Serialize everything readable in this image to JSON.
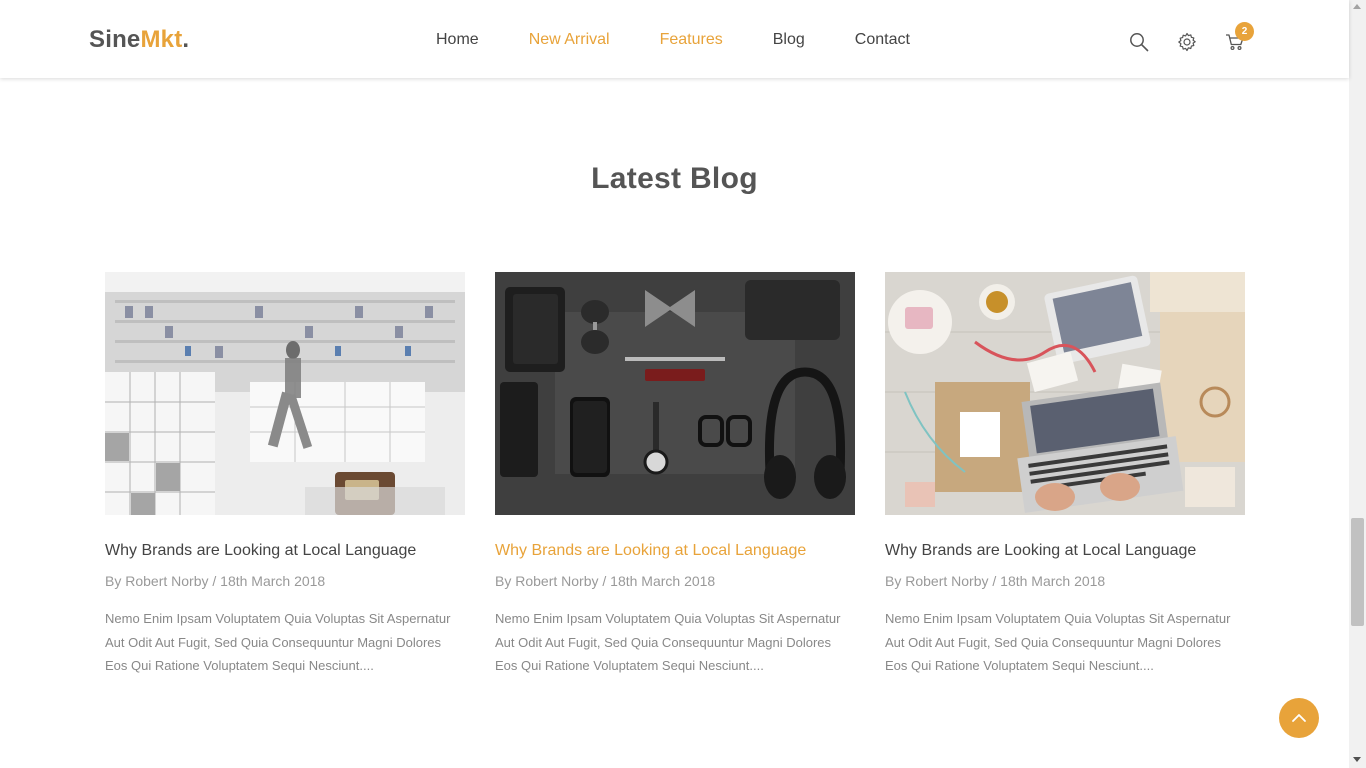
{
  "header": {
    "logo_main": "Sine",
    "logo_accent": "Mkt",
    "logo_dot": ".",
    "nav": [
      {
        "label": "Home",
        "active": false
      },
      {
        "label": "New Arrival",
        "active": true
      },
      {
        "label": "Features",
        "active": true
      },
      {
        "label": "Blog",
        "active": false
      },
      {
        "label": "Contact",
        "active": false
      }
    ],
    "icons": [
      "search-icon",
      "gear-icon",
      "cart-icon"
    ],
    "cart_count": "2"
  },
  "section": {
    "title": "Latest Blog"
  },
  "posts": [
    {
      "title": "Why Brands are Looking at Local Language",
      "meta": "By Robert Norby / 18th March 2018",
      "excerpt": "Nemo Enim Ipsam Voluptatem Quia Voluptas Sit Aspernatur Aut Odit Aut Fugit, Sed Quia Consequuntur Magni Dolores Eos Qui Ratione Voluptatem Sequi Nesciunt....",
      "highlighted": false
    },
    {
      "title": "Why Brands are Looking at Local Language",
      "meta": "By Robert Norby / 18th March 2018",
      "excerpt": "Nemo Enim Ipsam Voluptatem Quia Voluptas Sit Aspernatur Aut Odit Aut Fugit, Sed Quia Consequuntur Magni Dolores Eos Qui Ratione Voluptatem Sequi Nesciunt....",
      "highlighted": true
    },
    {
      "title": "Why Brands are Looking at Local Language",
      "meta": "By Robert Norby / 18th March 2018",
      "excerpt": "Nemo Enim Ipsam Voluptatem Quia Voluptas Sit Aspernatur Aut Odit Aut Fugit, Sed Quia Consequuntur Magni Dolores Eos Qui Ratione Voluptatem Sequi Nesciunt....",
      "highlighted": false
    }
  ],
  "colors": {
    "accent": "#e8a33a",
    "text": "#444444",
    "muted": "#999999"
  },
  "back_to_top_icon": "chevron-up-icon"
}
